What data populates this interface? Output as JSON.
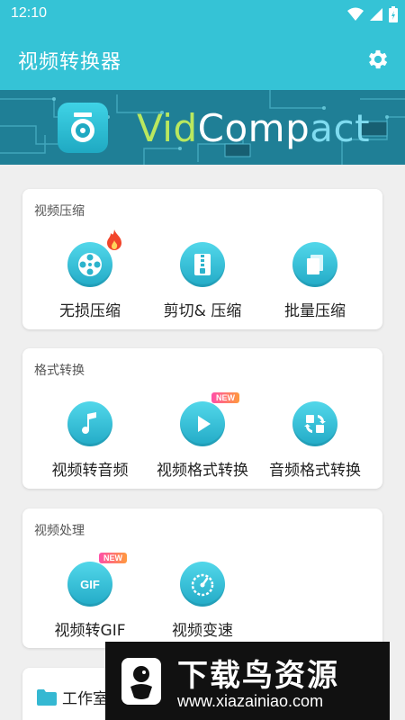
{
  "status_bar": {
    "time": "12:10"
  },
  "app": {
    "title": "视频转换器"
  },
  "banner": {
    "brand_part1": "Vid",
    "brand_part2": "Comp",
    "brand_part3": "act"
  },
  "sections": [
    {
      "title": "视频压缩",
      "tools": [
        {
          "label": "无损压缩",
          "icon": "film-reel-icon",
          "badge": "fire"
        },
        {
          "label": "剪切& 压缩",
          "icon": "zipper-icon"
        },
        {
          "label": "批量压缩",
          "icon": "stack-pages-icon"
        }
      ]
    },
    {
      "title": "格式转换",
      "tools": [
        {
          "label": "视频转音频",
          "icon": "music-note-icon"
        },
        {
          "label": "视频格式转换",
          "icon": "play-icon",
          "badge": "NEW"
        },
        {
          "label": "音频格式转换",
          "icon": "convert-arrows-icon"
        }
      ]
    },
    {
      "title": "视频处理",
      "tools": [
        {
          "label": "视频转GIF",
          "icon": "gif-icon",
          "badge": "NEW"
        },
        {
          "label": "视频变速",
          "icon": "speedometer-icon"
        }
      ]
    }
  ],
  "workshop": {
    "label": "工作室"
  },
  "watermark": {
    "title": "下载鸟资源",
    "url": "www.xiazainiao.com"
  },
  "colors": {
    "primary": "#35c3d6",
    "icon_gradient_top": "#52d7ea",
    "icon_gradient_bottom": "#22aac6",
    "badge_new": "#ff4fa8"
  }
}
